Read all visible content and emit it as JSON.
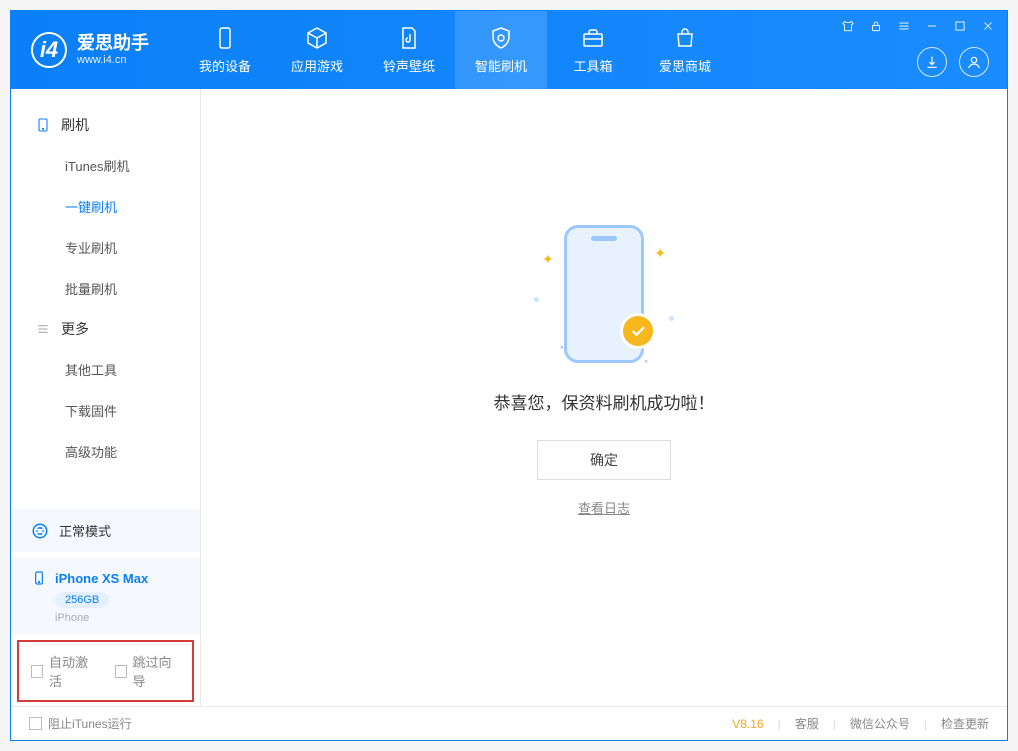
{
  "app": {
    "title": "爱思助手",
    "subtitle": "www.i4.cn"
  },
  "tabs": {
    "device": "我的设备",
    "apps": "应用游戏",
    "ringtones": "铃声壁纸",
    "flash": "智能刷机",
    "toolbox": "工具箱",
    "store": "爱思商城"
  },
  "sidebar": {
    "cat_flash": "刷机",
    "items_flash": {
      "itunes": "iTunes刷机",
      "onekey": "一键刷机",
      "pro": "专业刷机",
      "batch": "批量刷机"
    },
    "cat_more": "更多",
    "items_more": {
      "other": "其他工具",
      "firmware": "下载固件",
      "advanced": "高级功能"
    }
  },
  "status": {
    "mode": "正常模式",
    "device_name": "iPhone XS Max",
    "storage": "256GB",
    "device_type": "iPhone"
  },
  "options": {
    "auto_activate": "自动激活",
    "skip_guide": "跳过向导"
  },
  "main": {
    "success": "恭喜您，保资料刷机成功啦！",
    "ok": "确定",
    "view_log": "查看日志"
  },
  "footer": {
    "block_itunes": "阻止iTunes运行",
    "version": "V8.16",
    "support": "客服",
    "wechat": "微信公众号",
    "update": "检查更新"
  }
}
